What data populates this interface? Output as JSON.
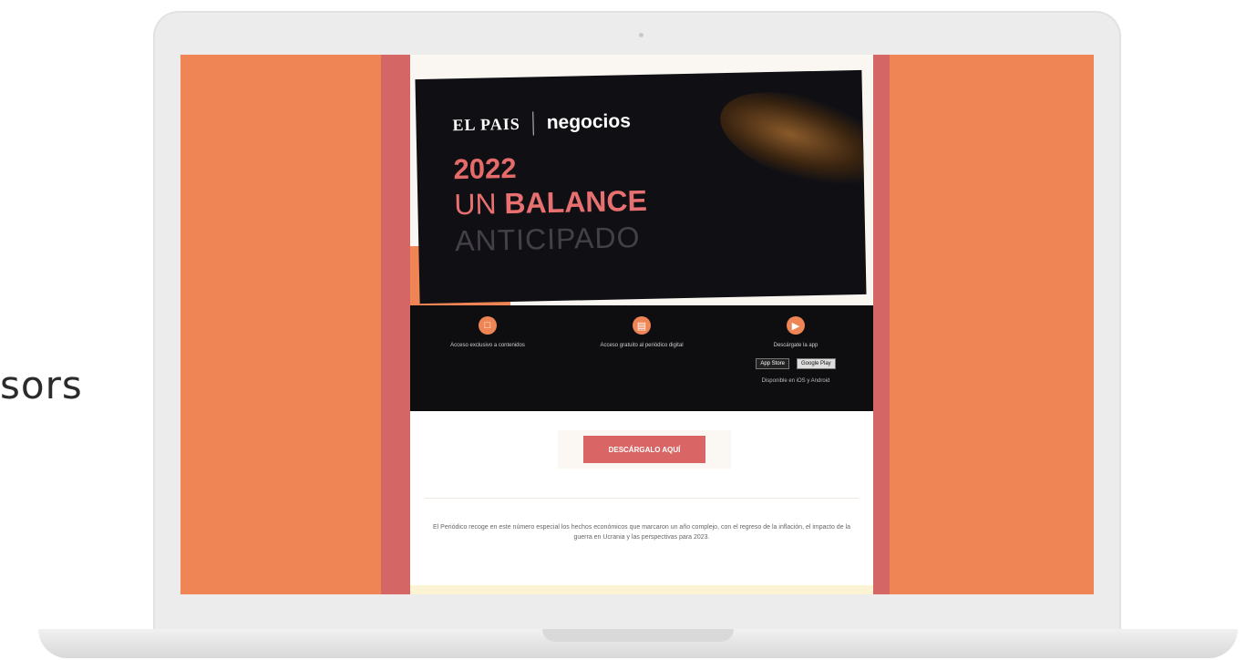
{
  "side_text": "sors",
  "email": {
    "brand": {
      "elpais": "EL PAIS",
      "negocios": "negocios"
    },
    "headline": {
      "year": "2022",
      "un": "UN ",
      "balance": "BALANCE",
      "anticipado": "ANTICIPADO"
    },
    "features": [
      {
        "icon": "newspaper-icon",
        "text": "Acceso exclusivo a contenidos"
      },
      {
        "icon": "document-icon",
        "text": "Acceso gratuito al periódico digital"
      },
      {
        "icon": "play-icon",
        "text": "Descárgate la app",
        "stores": [
          "App Store",
          "Google Play"
        ],
        "sub": "Disponible en iOS y Android"
      }
    ],
    "cta_label": "DESCÁRGALO AQUÍ",
    "body_text": "El Periódico recoge en este número especial los hechos económicos que marcaron un año complejo, con el regreso de la inflación, el impacto de la guerra en Ucrania y las perspectivas para 2023."
  }
}
